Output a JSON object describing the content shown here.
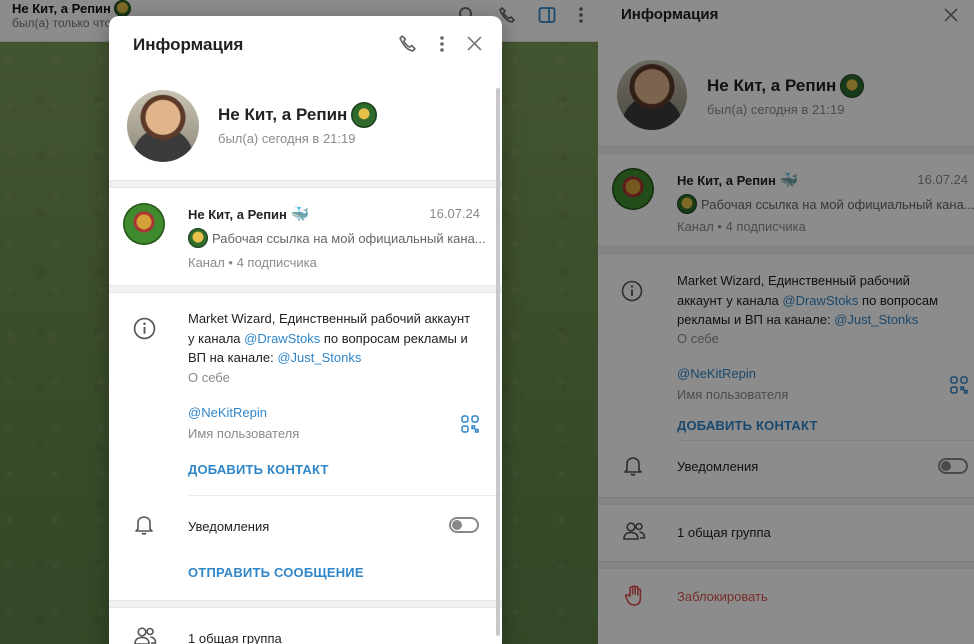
{
  "chat_header": {
    "title": "Не Кит, а Репин",
    "subtitle": "был(а) только что"
  },
  "modal": {
    "title": "Информация",
    "profile": {
      "name": "Не Кит, а Репин",
      "status": "был(а) сегодня в 21:19"
    },
    "channel": {
      "name": "Не Кит, а Репин",
      "date": "16.07.24",
      "message": "Рабочая ссылка на мой официальный кана...",
      "meta": "Канал • 4 подписчика"
    },
    "about": {
      "part1": "Market Wizard, Единственный рабочий аккаунт у канала ",
      "link1": "@DrawStoks",
      "part2": " по вопросам рекламы и ВП на канале: ",
      "link2": "@Just_Stonks",
      "label": "О себе"
    },
    "username": {
      "value": "@NeKitRepin",
      "label": "Имя пользователя"
    },
    "add_contact": "ДОБАВИТЬ КОНТАКТ",
    "notifications": "Уведомления",
    "send_message": "ОТПРАВИТЬ СООБЩЕНИЕ",
    "groups": "1 общая группа"
  },
  "side": {
    "title": "Информация",
    "profile": {
      "name": "Не Кит, а Репин",
      "status": "был(а) сегодня в 21:19"
    },
    "channel": {
      "name": "Не Кит, а Репин",
      "date": "16.07.24",
      "message": "Рабочая ссылка на мой официальный кана...",
      "meta": "Канал • 4 подписчика"
    },
    "about": {
      "part1": "Market Wizard, Единственный рабочий аккаунт у канала ",
      "link1": "@DrawStoks",
      "part2": " по вопросам рекламы и ВП на канале: ",
      "link2": "@Just_Stonks",
      "label": "О себе"
    },
    "username": {
      "value": "@NeKitRepin",
      "label": "Имя пользователя"
    },
    "add_contact": "ДОБАВИТЬ КОНТАКТ",
    "notifications": "Уведомления",
    "groups": "1 общая группа",
    "block": "Заблокировать"
  },
  "colors": {
    "accent": "#2f86c9",
    "danger": "#d9534f"
  },
  "icons": [
    "phone-icon",
    "more-icon",
    "close-icon",
    "info-icon",
    "bell-icon",
    "group-icon",
    "qr-icon",
    "hand-icon",
    "search-icon",
    "sidebar-icon"
  ]
}
